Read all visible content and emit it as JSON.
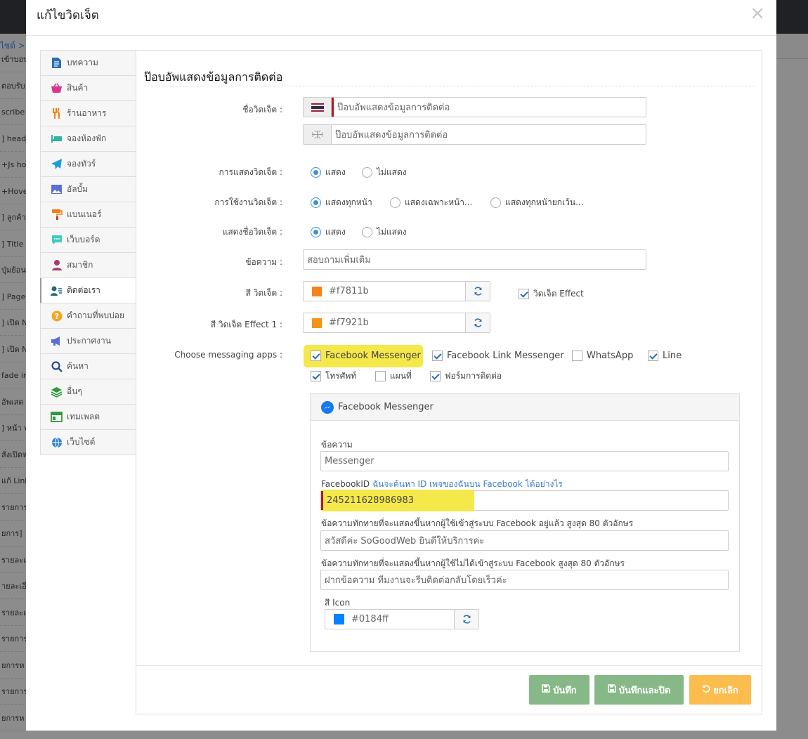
{
  "background": {
    "breadcrumb": "ไซต์ >",
    "items": [
      "เข้าบอนด์",
      "ตอบรับ",
      "scribe",
      "] head",
      "+Js hov",
      "+Hover",
      "] ลูกค้า",
      "] Title t",
      "ปุ่มย้อน",
      "] Page",
      "] เปิด N",
      "] เปิด N",
      "fade in",
      "อัพเสด",
      "] หน้า v",
      "สั่งเปิดห",
      "แก้ Link",
      "รายการ",
      "ยการ]",
      "รายละเ",
      "ายละเอีย",
      "รายละเ",
      "รายการ",
      "ยการห",
      "รายการ",
      "ยการห"
    ]
  },
  "modal": {
    "title": "แก้ไขวิดเจ็ต",
    "close": "×"
  },
  "nav": {
    "items": [
      {
        "label": "บทความ",
        "icon": "document-icon"
      },
      {
        "label": "สินค้า",
        "icon": "basket-icon"
      },
      {
        "label": "ร้านอาหาร",
        "icon": "cutlery-icon"
      },
      {
        "label": "จองห้องพัก",
        "icon": "bed-icon"
      },
      {
        "label": "จองทัวร์",
        "icon": "plane-icon"
      },
      {
        "label": "อัลบั้ม",
        "icon": "image-icon"
      },
      {
        "label": "แบนเนอร์",
        "icon": "paint-roller-icon"
      },
      {
        "label": "เว็บบอร์ด",
        "icon": "comment-icon"
      },
      {
        "label": "สมาชิก",
        "icon": "user-icon"
      },
      {
        "label": "ติดต่อเรา",
        "icon": "contact-user-icon"
      },
      {
        "label": "คำถามที่พบบ่อย",
        "icon": "question-icon"
      },
      {
        "label": "ประกาศงาน",
        "icon": "megaphone-icon"
      },
      {
        "label": "ค้นหา",
        "icon": "search-icon"
      },
      {
        "label": "อื่นๆ",
        "icon": "layers-icon"
      },
      {
        "label": "เทมเพลต",
        "icon": "template-icon"
      },
      {
        "label": "เว็บไซต์",
        "icon": "globe-icon"
      }
    ],
    "active_index": 9
  },
  "form": {
    "section_title": "ป๊อบอัพแสดงข้อมูลการติดต่อ",
    "widget_name_label": "ชื่อวิดเจ็ต :",
    "widget_name_th": "ป๊อบอัพแสดงข้อมูลการติดต่อ",
    "widget_name_en": "ป๊อบอัพแสดงข้อมูลการติดต่อ",
    "display_label": "การแสดงวิดเจ็ต :",
    "display_options": [
      "แสดง",
      "ไม่แสดง"
    ],
    "display_selected": 0,
    "usage_label": "การใช้งานวิดเจ็ต :",
    "usage_options": [
      "แสดงทุกหน้า",
      "แสดงเฉพาะหน้า...",
      "แสดงทุกหน้ายกเว้น..."
    ],
    "usage_selected": 0,
    "show_name_label": "แสดงชื่อวิดเจ็ต :",
    "show_name_options": [
      "แสดง",
      "ไม่แสดง"
    ],
    "show_name_selected": 0,
    "message_label": "ข้อความ :",
    "message_value": "สอบถามเพิ่มเติม",
    "color_label": "สี วิดเจ็ต :",
    "color_value": "#f7811b",
    "effect_label": "วิดเจ็ต Effect",
    "effect_checked": true,
    "color1_label": "สี วิดเจ็ต Effect 1 :",
    "color1_value": "#f7921b",
    "apps_label": "Choose messaging apps :",
    "apps": [
      {
        "label": "Facebook Messenger",
        "checked": true
      },
      {
        "label": "Facebook Link Messenger",
        "checked": true
      },
      {
        "label": "WhatsApp",
        "checked": false
      },
      {
        "label": "Line",
        "checked": true
      },
      {
        "label": "โทรศัพท์",
        "checked": true
      },
      {
        "label": "แผนที่",
        "checked": false
      },
      {
        "label": "ฟอร์มการติดต่อ",
        "checked": true
      }
    ]
  },
  "messenger_panel": {
    "title": "Facebook Messenger",
    "message_label": "ข้อความ",
    "message_value": "Messenger",
    "fbid_label": "FacebookID",
    "fbid_help_link": "ฉันจะค้นหา ID เพจของฉันบน Facebook ได้อย่างไร",
    "fbid_value": "245211628986983",
    "greeting_in_label": "ข้อความทักทายที่จะแสดงขึ้นหากผู้ใช้เข้าสู่ระบบ Facebook อยู่แล้ว สูงสุด 80 ตัวอักษร",
    "greeting_in_value": "สวัสดีค่ะ SoGoodWeb ยินดีให้บริการค่ะ",
    "greeting_out_label": "ข้อความทักทายที่จะแสดงขึ้นหากผู้ใช้ไม่ได้เข้าสู่ระบบ Facebook สูงสุด 80 ตัวอักษร",
    "greeting_out_value": "ฝากข้อความ ทีมงานจะรีบติดต่อกลับโดยเร็วค่ะ",
    "icon_color_label": "สี Icon",
    "icon_color_value": "#0184ff"
  },
  "footer": {
    "save_label": "บันทึก",
    "save_close_label": "บันทึกและปิด",
    "cancel_label": "ยกเลิก"
  },
  "colors": {
    "widget": "#f7811b",
    "widget_effect": "#f7921b",
    "icon": "#0184ff",
    "highlight": "#f5e84a",
    "btn_green": "#86b987",
    "btn_orange": "#fbbd4e"
  }
}
